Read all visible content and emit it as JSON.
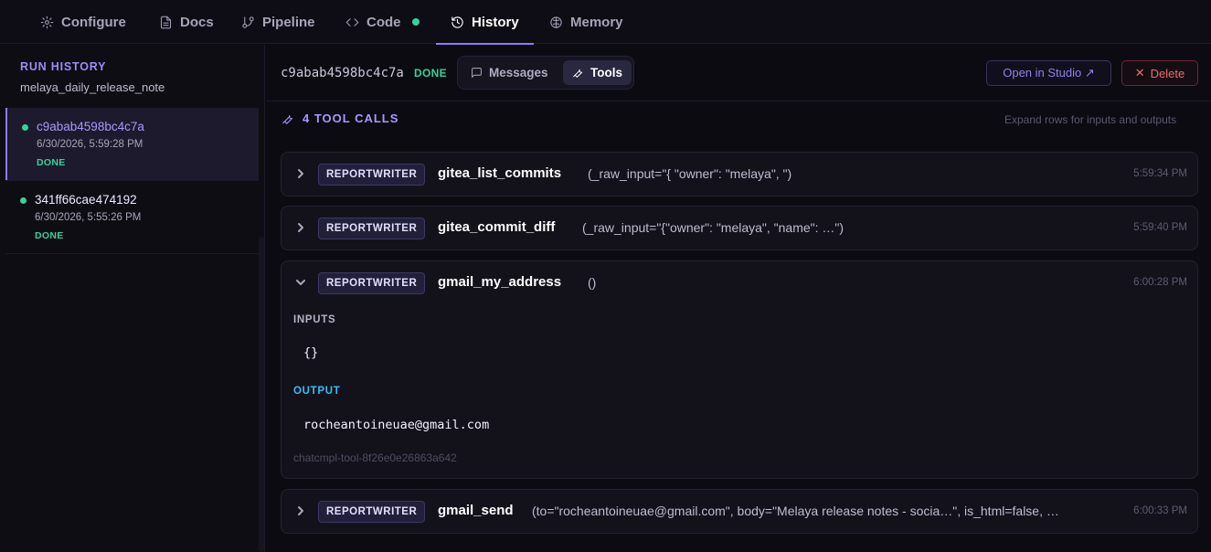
{
  "nav": {
    "tabs": [
      {
        "label": "Configure",
        "icon": "gear-icon"
      },
      {
        "label": "Docs",
        "icon": "document-icon"
      },
      {
        "label": "Pipeline",
        "icon": "branch-icon"
      },
      {
        "label": "Code",
        "icon": "code-icon",
        "status_dot": "#34d399"
      },
      {
        "label": "History",
        "icon": "history-icon",
        "active": true
      },
      {
        "label": "Memory",
        "icon": "brain-icon"
      }
    ]
  },
  "sidebar": {
    "title": "RUN HISTORY",
    "subtitle": "melaya_daily_release_note",
    "runs": [
      {
        "id": "c9abab4598bc4c7a",
        "date": "6/30/2026, 5:59:28 PM",
        "status": "DONE",
        "selected": true
      },
      {
        "id": "341ff66cae474192",
        "date": "6/30/2026, 5:55:26 PM",
        "status": "DONE",
        "selected": false
      }
    ]
  },
  "run": {
    "id": "c9abab4598bc4c7a",
    "status": "DONE",
    "view_tabs": {
      "messages": "Messages",
      "tools": "Tools"
    },
    "open_studio": "Open in Studio ↗",
    "delete": "Delete"
  },
  "tools": {
    "header": "4 TOOL CALLS",
    "hint": "Expand rows for inputs and outputs",
    "calls": [
      {
        "agent": "REPORTWRITER",
        "name": "gitea_list_commits",
        "args": "(_raw_input=\"{ \"owner\": \"melaya\", \")",
        "time": "5:59:34 PM",
        "expanded": false
      },
      {
        "agent": "REPORTWRITER",
        "name": "gitea_commit_diff",
        "args": "(_raw_input=\"{\"owner\": \"melaya\", \"name\": …\")",
        "time": "5:59:40 PM",
        "expanded": false
      },
      {
        "agent": "REPORTWRITER",
        "name": "gmail_my_address",
        "args": "()",
        "time": "6:00:28 PM",
        "expanded": true,
        "inputs_label": "INPUTS",
        "inputs": "{}",
        "output_label": "OUTPUT",
        "output": "rocheantoineuae@gmail.com",
        "call_id": "chatcmpl-tool-8f26e0e26863a642"
      },
      {
        "agent": "REPORTWRITER",
        "name": "gmail_send",
        "args": "(to=\"rocheantoineuae@gmail.com\", body=\"Melaya release notes - socia…\", is_html=false, …",
        "time": "6:00:33 PM",
        "expanded": false
      }
    ]
  },
  "colors": {
    "accent": "#8b7cf6",
    "success": "#34d399",
    "danger": "#ef6b6b",
    "output_label": "#38bdf8"
  }
}
